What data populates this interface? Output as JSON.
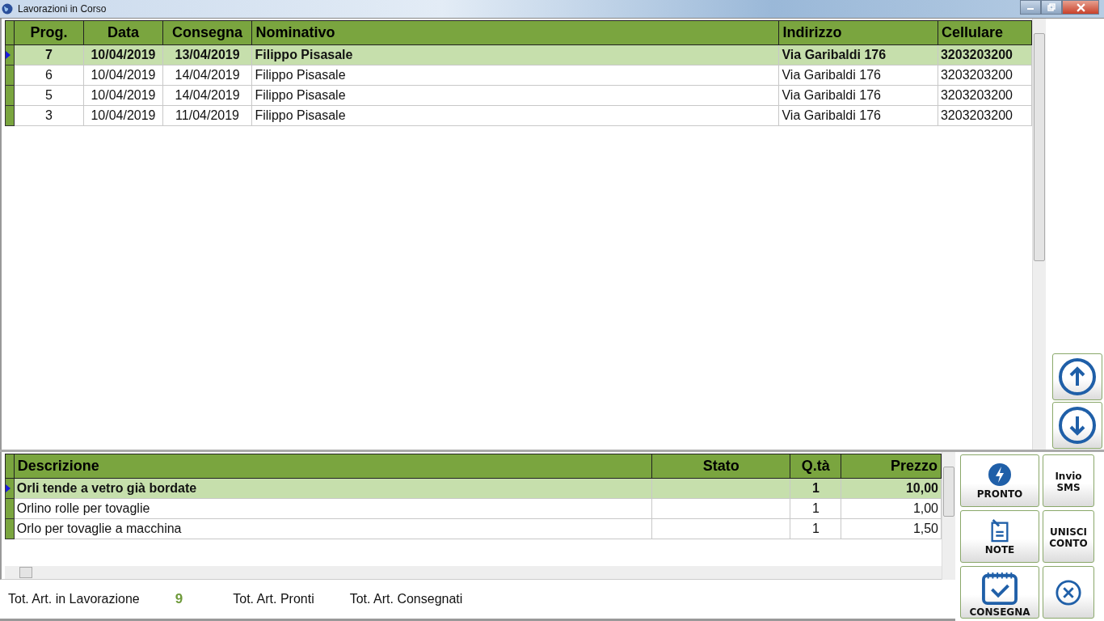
{
  "window": {
    "title": "Lavorazioni in Corso"
  },
  "orders": {
    "columns": [
      {
        "label": "Prog."
      },
      {
        "label": "Data"
      },
      {
        "label": "Consegna"
      },
      {
        "label": "Nominativo"
      },
      {
        "label": "Indirizzo"
      },
      {
        "label": "Cellulare"
      }
    ],
    "rows": [
      {
        "selected": true,
        "cells": [
          "7",
          "10/04/2019",
          "13/04/2019",
          "Filippo Pisasale",
          "Via Garibaldi 176",
          "3203203200"
        ]
      },
      {
        "selected": false,
        "cells": [
          "6",
          "10/04/2019",
          "14/04/2019",
          "Filippo Pisasale",
          "Via Garibaldi 176",
          "3203203200"
        ]
      },
      {
        "selected": false,
        "cells": [
          "5",
          "10/04/2019",
          "14/04/2019",
          "Filippo Pisasale",
          "Via Garibaldi 176",
          "3203203200"
        ]
      },
      {
        "selected": false,
        "cells": [
          "3",
          "10/04/2019",
          "11/04/2019",
          "Filippo Pisasale",
          "Via Garibaldi 176",
          "3203203200"
        ]
      }
    ]
  },
  "items": {
    "columns": [
      {
        "label": "Descrizione"
      },
      {
        "label": "Stato"
      },
      {
        "label": "Q.tà"
      },
      {
        "label": "Prezzo"
      }
    ],
    "rows": [
      {
        "selected": true,
        "cells": [
          "Orli tende a vetro già bordate",
          "",
          "1",
          "10,00"
        ]
      },
      {
        "selected": false,
        "cells": [
          "Orlino rolle per tovaglie",
          "",
          "1",
          "1,00"
        ]
      },
      {
        "selected": false,
        "cells": [
          "Orlo per tovaglie a macchina",
          "",
          "1",
          "1,50"
        ]
      }
    ]
  },
  "nav_buttons": [
    {
      "kind": "up"
    },
    {
      "kind": "down"
    }
  ],
  "action_buttons": [
    {
      "kind": "bolt",
      "label": "PRONTO"
    },
    {
      "kind": "text",
      "label": "Invio SMS"
    },
    {
      "kind": "note",
      "label": "NOTE"
    },
    {
      "kind": "text",
      "label": "UNISCI CONTO"
    },
    {
      "kind": "check",
      "label": "CONSEGNA"
    },
    {
      "kind": "close"
    }
  ],
  "totals": [
    {
      "label": "Tot. Art. in Lavorazione",
      "value": "9"
    },
    {
      "label": "Tot. Art. Pronti"
    },
    {
      "label": "Tot. Art. Consegnati"
    }
  ]
}
